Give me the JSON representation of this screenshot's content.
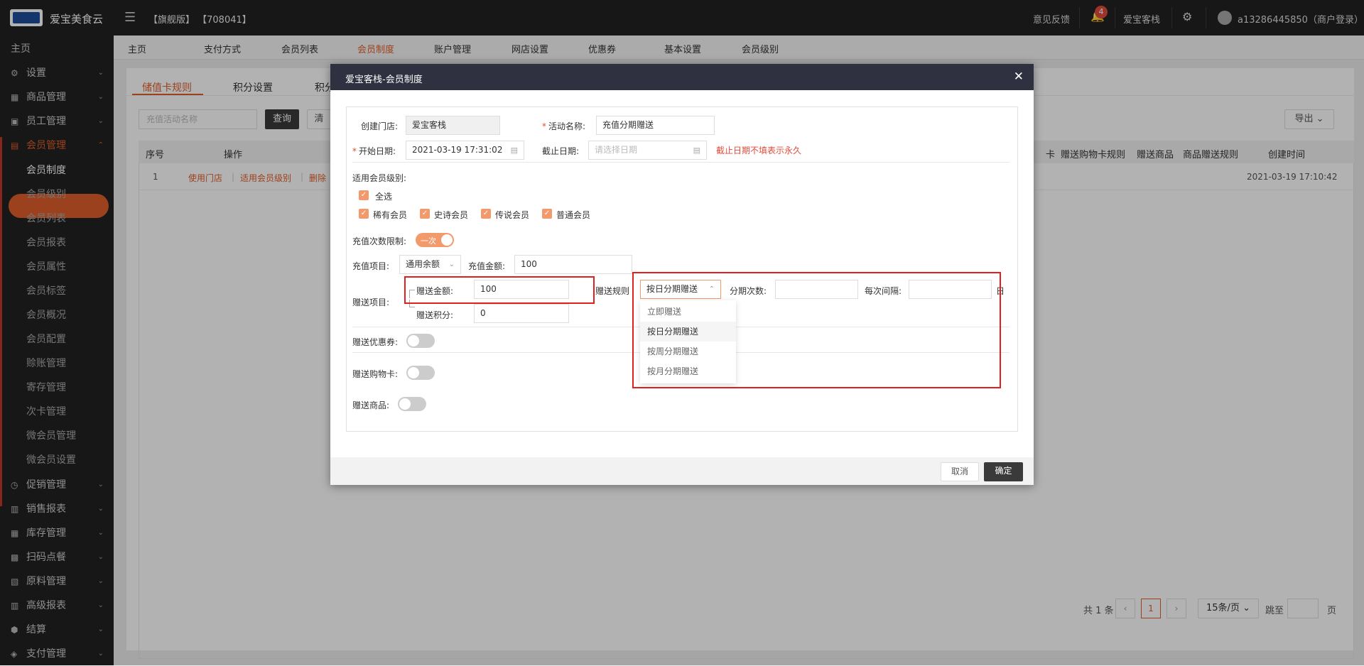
{
  "topbar": {
    "brand": "爱宝美食云",
    "edition": "【旗舰版】 【708041】",
    "feedback": "意见反馈",
    "notif_count": "4",
    "store": "爱宝客栈",
    "user": "a13286445850（商户登录）"
  },
  "sidebar": {
    "home": "主页",
    "sections": [
      {
        "label": "设置",
        "icon": "gear-icon"
      },
      {
        "label": "商品管理",
        "icon": "goods-icon"
      },
      {
        "label": "员工管理",
        "icon": "staff-icon"
      },
      {
        "label": "会员管理",
        "icon": "member-icon"
      }
    ],
    "member_subs": [
      "会员制度",
      "会员级别",
      "会员列表",
      "会员报表",
      "会员属性",
      "会员标签",
      "会员概况",
      "会员配置",
      "赊账管理",
      "寄存管理",
      "次卡管理",
      "微会员管理",
      "微会员设置"
    ],
    "bottom_sections": [
      "促销管理",
      "销售报表",
      "库存管理",
      "扫码点餐",
      "原料管理",
      "高级报表",
      "结算",
      "支付管理"
    ]
  },
  "tabs": [
    "主页",
    "支付方式",
    "会员列表",
    "会员制度",
    "账户管理",
    "网店设置",
    "优惠券",
    "基本设置",
    "会员级别"
  ],
  "inner_tabs": [
    "储值卡规则",
    "积分设置",
    "积分"
  ],
  "toolbar": {
    "search_placeholder": "充值活动名称",
    "query": "查询",
    "clear": "清",
    "export": "导出"
  },
  "table": {
    "headers_left": [
      "序号",
      "操作"
    ],
    "headers_right": [
      "卡",
      "赠送购物卡规则",
      "赠送商品",
      "商品赠送规则",
      "创建时间"
    ],
    "row": {
      "index": "1",
      "action1": "使用门店",
      "action2": "适用会员级别",
      "action3": "删除",
      "created": "2021-03-19 17:10:42"
    }
  },
  "pager": {
    "total": "共 1 条",
    "page": "1",
    "per_page": "15条/页",
    "jump": "跳至",
    "page_unit": "页"
  },
  "modal": {
    "title": "爱宝客栈-会员制度",
    "store_label": "创建门店:",
    "store_value": "爱宝客栈",
    "name_label": "活动名称:",
    "name_value": "充值分期赠送",
    "start_label": "开始日期:",
    "start_value": "2021-03-19 17:31:02",
    "end_label": "截止日期:",
    "end_placeholder": "请选择日期",
    "end_hint": "截止日期不填表示永久",
    "levels_label": "适用会员级别:",
    "select_all": "全选",
    "levels": [
      "稀有会员",
      "史诗会员",
      "传说会员",
      "普通会员"
    ],
    "limit_label": "充值次数限制:",
    "limit_switch": "一次",
    "recharge_item_label": "充值项目:",
    "recharge_item_value": "通用余额",
    "recharge_amount_label": "充值金额:",
    "recharge_amount_value": "100",
    "gift_item_label": "赠送项目:",
    "gift_amount_label": "赠送金额:",
    "gift_amount_value": "100",
    "gift_rule_label": "赠送规则",
    "gift_rule_value": "按日分期赠送",
    "installments_label": "分期次数:",
    "interval_label": "每次间隔:",
    "interval_unit": "日",
    "gift_points_label": "赠送积分:",
    "gift_points_value": "0",
    "coupon_label": "赠送优惠券:",
    "card_label": "赠送购物卡:",
    "goods_label": "赠送商品:",
    "rule_options": [
      "立即赠送",
      "按日分期赠送",
      "按周分期赠送",
      "按月分期赠送"
    ],
    "cancel": "取消",
    "confirm": "确定"
  }
}
